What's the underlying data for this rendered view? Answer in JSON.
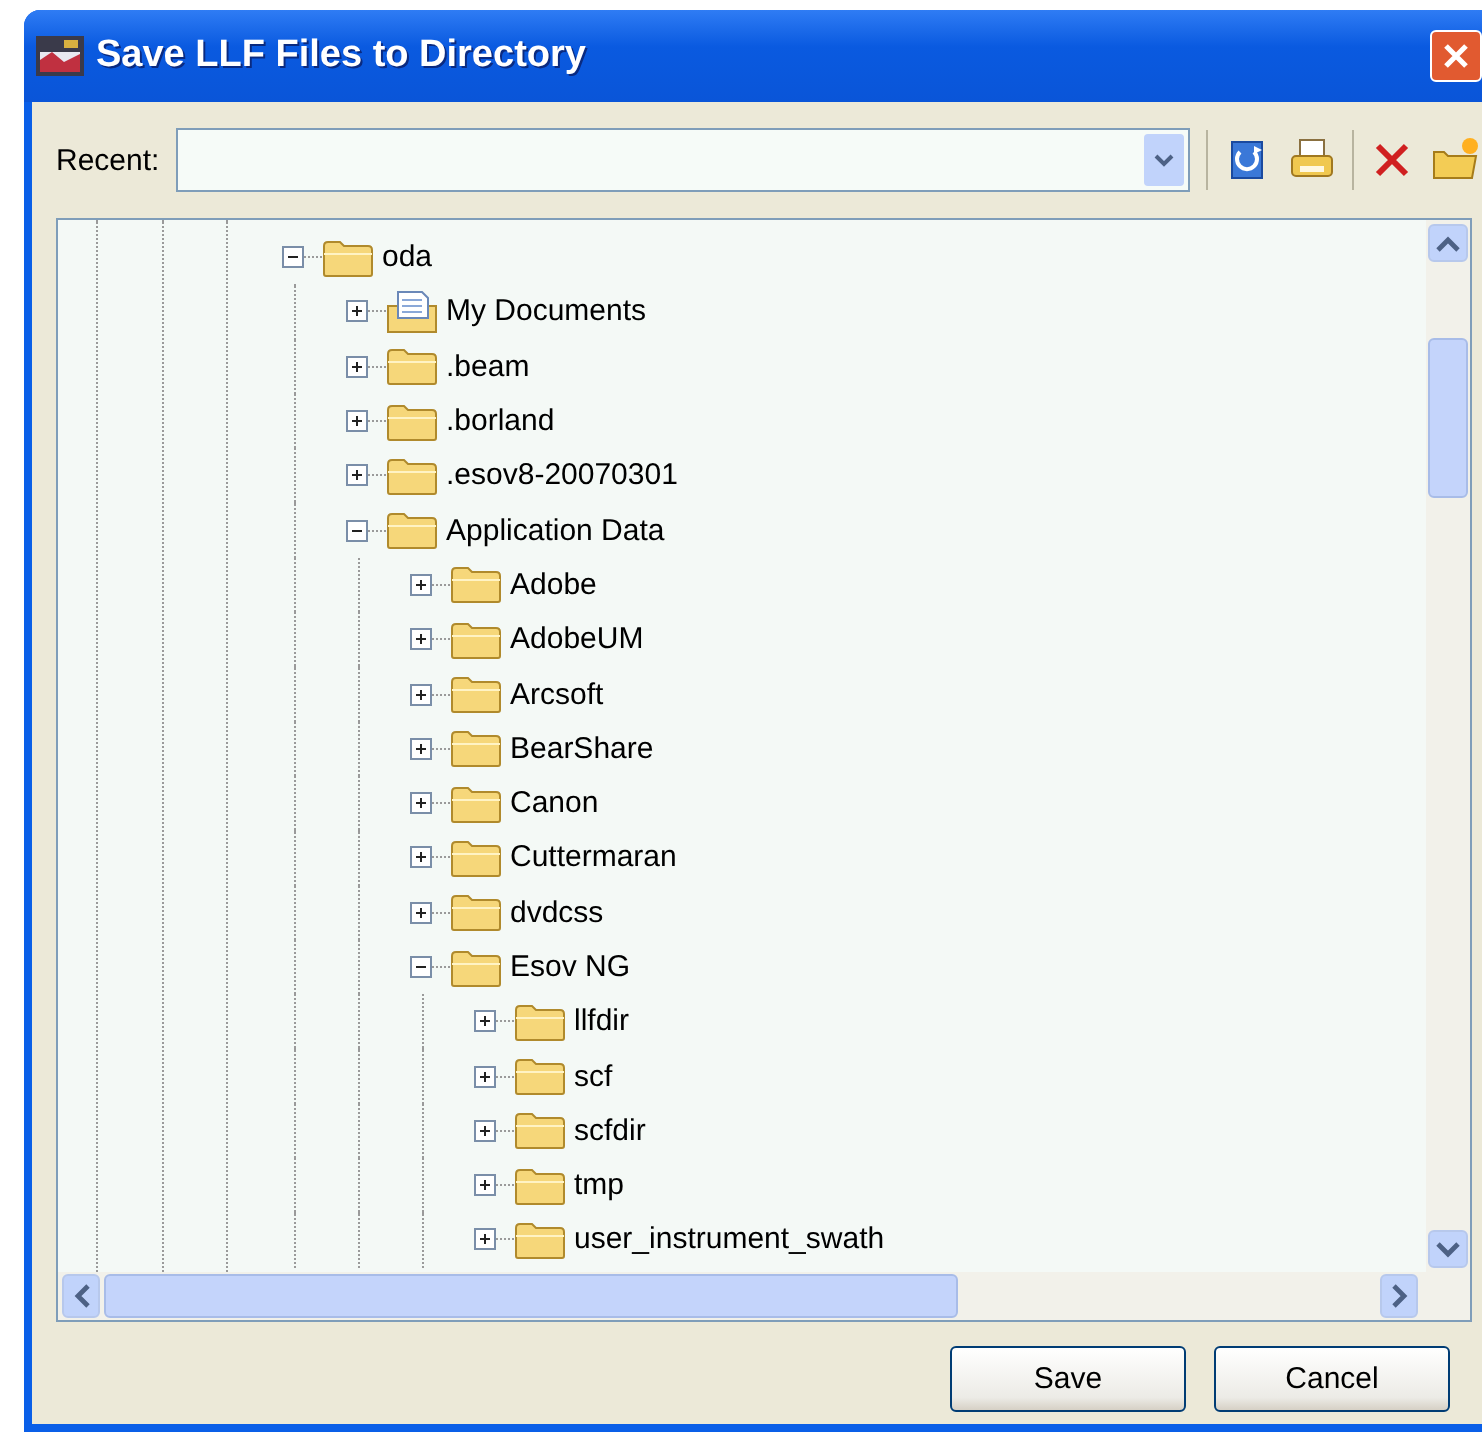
{
  "window": {
    "title": "Save LLF Files to Directory"
  },
  "toolbar": {
    "recent_label": "Recent:"
  },
  "tree": [
    {
      "label": "oda",
      "kind": "folder",
      "expanded": true,
      "children": [
        {
          "label": "My Documents",
          "kind": "documents",
          "expanded": false
        },
        {
          "label": ".beam",
          "kind": "folder",
          "expanded": false
        },
        {
          "label": ".borland",
          "kind": "folder",
          "expanded": false
        },
        {
          "label": ".esov8-20070301",
          "kind": "folder",
          "expanded": false
        },
        {
          "label": "Application Data",
          "kind": "folder",
          "expanded": true,
          "children": [
            {
              "label": "Adobe",
              "kind": "folder",
              "expanded": false
            },
            {
              "label": "AdobeUM",
              "kind": "folder",
              "expanded": false
            },
            {
              "label": "Arcsoft",
              "kind": "folder",
              "expanded": false
            },
            {
              "label": "BearShare",
              "kind": "folder",
              "expanded": false
            },
            {
              "label": "Canon",
              "kind": "folder",
              "expanded": false
            },
            {
              "label": "Cuttermaran",
              "kind": "folder",
              "expanded": false
            },
            {
              "label": "dvdcss",
              "kind": "folder",
              "expanded": false
            },
            {
              "label": "Esov NG",
              "kind": "folder",
              "expanded": true,
              "children": [
                {
                  "label": "llfdir",
                  "kind": "folder",
                  "expanded": false
                },
                {
                  "label": "scf",
                  "kind": "folder",
                  "expanded": false
                },
                {
                  "label": "scfdir",
                  "kind": "folder",
                  "expanded": false
                },
                {
                  "label": "tmp",
                  "kind": "folder",
                  "expanded": false
                },
                {
                  "label": "user_instrument_swath",
                  "kind": "folder",
                  "expanded": false
                }
              ]
            }
          ]
        }
      ]
    }
  ],
  "buttons": [
    "Save",
    "Cancel"
  ]
}
